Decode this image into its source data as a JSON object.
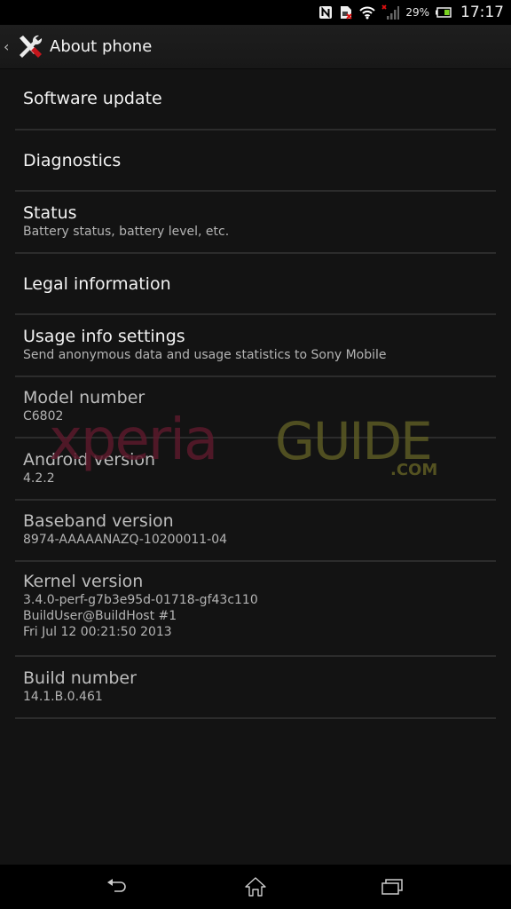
{
  "status_bar": {
    "icons": [
      "nfc-icon",
      "sim-missing-icon",
      "wifi-icon",
      "signal-no-service-icon",
      "battery-icon"
    ],
    "battery_percent": "29%",
    "time": "17:17"
  },
  "action_bar": {
    "back_glyph": "‹",
    "icon": "settings-tools-icon",
    "title": "About phone"
  },
  "items": [
    {
      "title": "Software update",
      "subtitle": null,
      "clickable": true
    },
    {
      "title": "Diagnostics",
      "subtitle": null,
      "clickable": true
    },
    {
      "title": "Status",
      "subtitle": "Battery status, battery level, etc.",
      "clickable": true
    },
    {
      "title": "Legal information",
      "subtitle": null,
      "clickable": true
    },
    {
      "title": "Usage info settings",
      "subtitle": "Send anonymous data and usage statistics to Sony Mobile",
      "clickable": true
    },
    {
      "title": "Model number",
      "subtitle": "C6802",
      "clickable": false
    },
    {
      "title": "Android version",
      "subtitle": "4.2.2",
      "clickable": true
    },
    {
      "title": "Baseband version",
      "subtitle": "8974-AAAAANAZQ-10200011-04",
      "clickable": false
    },
    {
      "title": "Kernel version",
      "subtitle_lines": [
        "3.4.0-perf-g7b3e95d-01718-gf43c110",
        "BuildUser@BuildHost #1",
        "Fri Jul 12 00:21:50 2013"
      ],
      "clickable": false
    },
    {
      "title": "Build number",
      "subtitle": "14.1.B.0.461",
      "clickable": true
    }
  ],
  "watermark": {
    "part1": "xperia",
    "part2": "GUIDE",
    "suffix": ".COM",
    "color1": "#5a1a2c",
    "color2": "#5c5a24"
  },
  "nav_bar": {
    "back": "back-icon",
    "home": "home-icon",
    "recents": "recent-apps-icon"
  }
}
